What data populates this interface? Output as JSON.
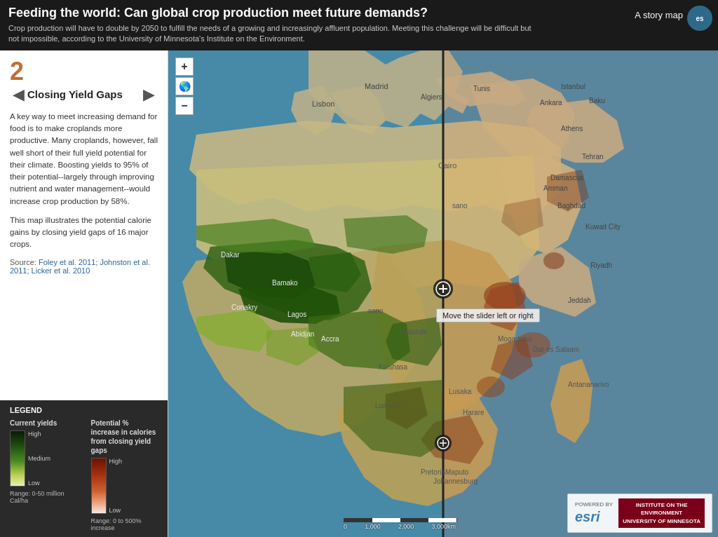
{
  "header": {
    "title": "Feeding the world: Can global crop production meet future demands?",
    "subtitle": "Crop production will have to double by 2050 to fulfill the needs of a growing and increasingly affluent population. Meeting this challenge will be difficult but not impossible, according to the University of Minnesota's Institute on the Environment.",
    "story_map_label": "A story map",
    "esri_label": "es"
  },
  "sidebar": {
    "slide_number": "2",
    "slide_title": "Closing Yield Gaps",
    "slide_body_1": "A key way to meet increasing demand for food is to make croplands more productive. Many croplands, however, fall well short of their full yield potential for their climate. Boosting yields to 95% of their potential--largely through improving nutrient and water management--would increase crop production by 58%.",
    "slide_body_2": "This map illustrates the potential calorie gains by closing yield gaps of 16 major crops.",
    "source_label": "Source:",
    "source_links": "Foley et al. 2011; Johnston et al. 2011; Licker et al. 2010"
  },
  "legend": {
    "title": "LEGEND",
    "item1_title": "Current yields",
    "item1_high": "High",
    "item1_medium": "Medium",
    "item1_low": "Low",
    "item1_range": "Range: 0-50 million Cal/ha",
    "item2_title": "Potential % increase in calories from closing yield gaps",
    "item2_high": "High",
    "item2_low": "Low",
    "item2_range": "Range: 0 to 500% increase"
  },
  "map": {
    "slider_tooltip": "Move the slider left or right",
    "controls": {
      "zoom_in": "+",
      "zoom_out": "−",
      "globe": "🌐"
    },
    "scale": {
      "labels": [
        "0",
        "1,000",
        "2,000",
        "3,000km"
      ]
    }
  },
  "branding": {
    "powered_by": "POWERED BY",
    "esri": "esri",
    "institute_line1": "INSTITUTE ON THE",
    "institute_line2": "ENVIRONMENT",
    "university": "UNIVERSITY OF MINNESOTA"
  },
  "colors": {
    "header_bg": "#1a1a1a",
    "ocean": "#4a8fb5",
    "land_base": "#d4c9a0",
    "green_high": "#2d5a1b",
    "green_low": "#c8d87a",
    "red_high": "#7a1a00",
    "red_low": "#f5d0c0",
    "sidebar_bg": "#ffffff",
    "legend_bg": "#2a2a2a",
    "accent": "#c0703a"
  }
}
